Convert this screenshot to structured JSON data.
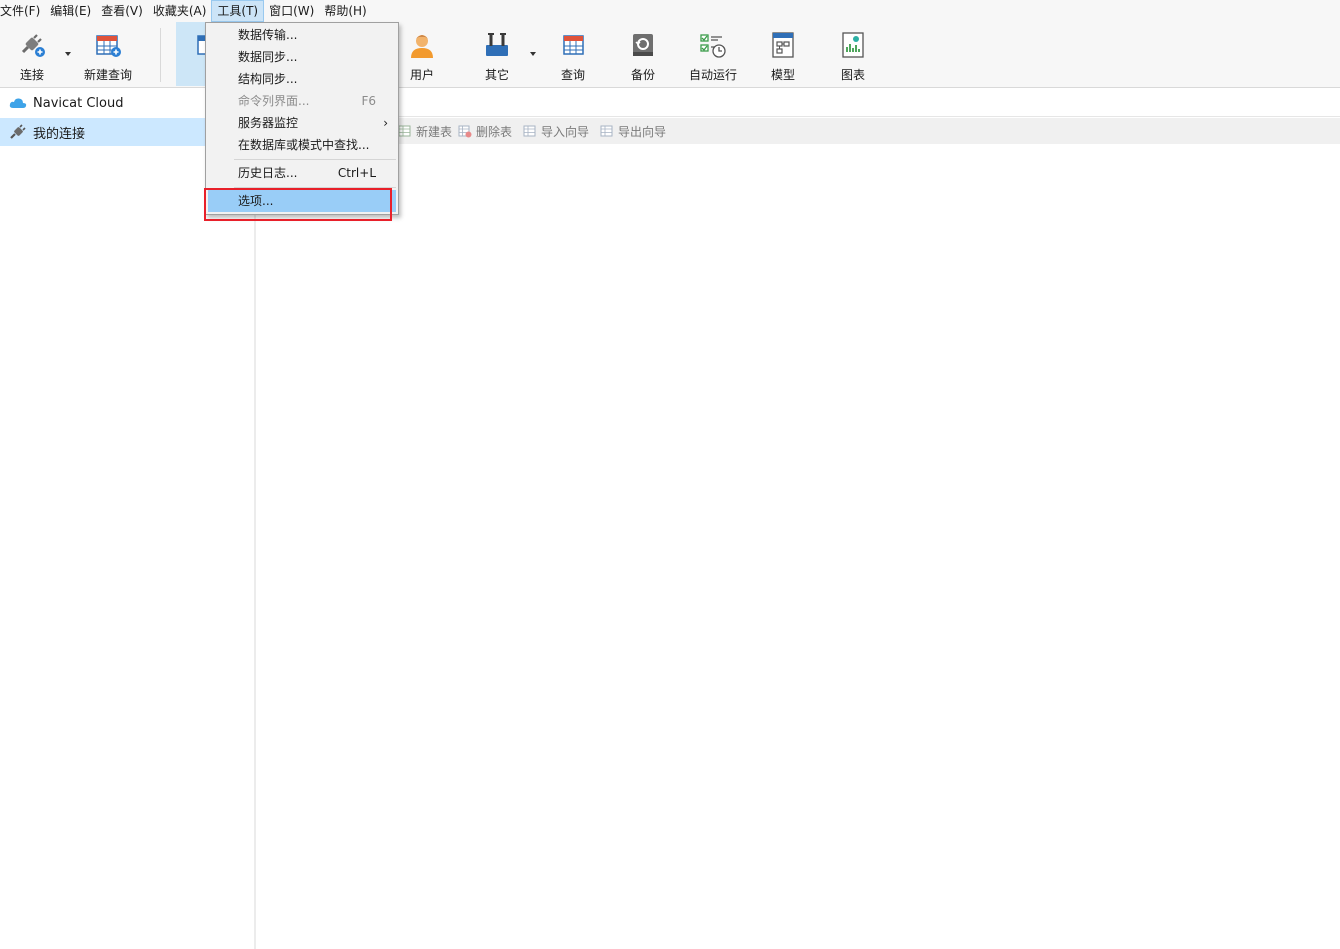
{
  "menubar": {
    "items": [
      "文件(F)",
      "编辑(E)",
      "查看(V)",
      "收藏夹(A)",
      "工具(T)",
      "窗口(W)",
      "帮助(H)"
    ]
  },
  "toolbar": {
    "connect": "连接",
    "new_query": "新建查询",
    "user": "用户",
    "other": "其它",
    "query": "查询",
    "backup": "备份",
    "autorun": "自动运行",
    "model": "模型",
    "chart": "图表"
  },
  "sidebar": {
    "cloud": "Navicat Cloud",
    "my_connections": "我的连接"
  },
  "objectbar": {
    "new_table": "新建表",
    "delete_table": "删除表",
    "import_wizard": "导入向导",
    "export_wizard": "导出向导"
  },
  "tools_menu": {
    "items": [
      {
        "label": "数据传输...",
        "shortcut": ""
      },
      {
        "label": "数据同步...",
        "shortcut": ""
      },
      {
        "label": "结构同步...",
        "shortcut": ""
      },
      {
        "label": "命令列界面...",
        "shortcut": "F6"
      },
      {
        "label": "服务器监控",
        "shortcut": ""
      },
      {
        "label": "在数据库或模式中查找...",
        "shortcut": ""
      },
      {
        "label": "历史日志...",
        "shortcut": "Ctrl+L"
      },
      {
        "label": "选项...",
        "shortcut": ""
      }
    ]
  },
  "colors": {
    "highlight": "#99cdf7",
    "selection": "#cce8ff",
    "annotation_box": "#e8202a"
  }
}
